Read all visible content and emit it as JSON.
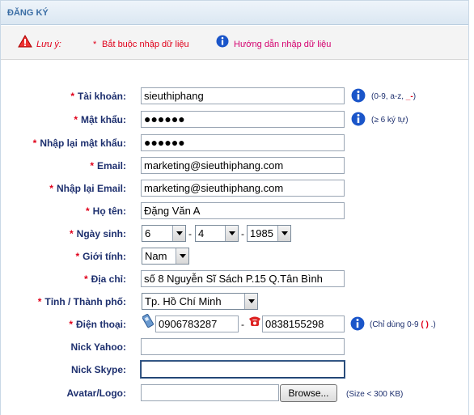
{
  "header": {
    "title": "ĐĂNG KÝ"
  },
  "notes": {
    "label": "Lưu ý:",
    "required_star": "*",
    "required_text": "Bắt buộc nhập dữ liệu",
    "help_text": "Hướng dẫn nhập dữ liệu"
  },
  "form": {
    "account": {
      "label": "Tài khoản:",
      "value": "sieuthiphang",
      "hint_prefix": "(0-9, a-z, ",
      "hint_symbols": "_-",
      "hint_suffix": ")"
    },
    "password": {
      "label": "Mật khẩu:",
      "value": "●●●●●●",
      "hint": "(≥ 6 ký tự)"
    },
    "password_confirm": {
      "label": "Nhập lại mật khẩu:",
      "value": "●●●●●●"
    },
    "email": {
      "label": "Email:",
      "value": "marketing@sieuthiphang.com"
    },
    "email_confirm": {
      "label": "Nhập lại Email:",
      "value": "marketing@sieuthiphang.com"
    },
    "fullname": {
      "label": "Họ tên:",
      "value": "Đặng Văn A"
    },
    "birthday": {
      "label": "Ngày sinh:",
      "day": "6",
      "month": "4",
      "year": "1985",
      "separator": "-"
    },
    "gender": {
      "label": "Giới tính:",
      "value": "Nam"
    },
    "address": {
      "label": "Địa chỉ:",
      "value": "số 8 Nguyễn Sĩ Sách P.15 Q.Tân Bình"
    },
    "city": {
      "label": "Tỉnh / Thành phố:",
      "value": "Tp. Hồ Chí Minh"
    },
    "phone": {
      "label": "Điện thoại:",
      "mobile": "0906783287",
      "landline": "0838155298",
      "separator": "-",
      "hint_prefix": "(Chỉ dùng 0-9 ",
      "hint_symbols": "( )",
      "hint_suffix": " .)"
    },
    "yahoo": {
      "label": "Nick Yahoo:",
      "value": ""
    },
    "skype": {
      "label": "Nick Skype:",
      "value": ""
    },
    "avatar": {
      "label": "Avatar/Logo:",
      "value": "",
      "button": "Browse...",
      "hint": "(Size < 300 KB)"
    },
    "required_star": "*"
  },
  "colors": {
    "label": "#1d2f6e",
    "required": "#e0001a",
    "title": "#3b6ea5",
    "help": "#d4006e"
  },
  "icons": [
    "warning-icon",
    "info-icon",
    "mobile-phone-icon",
    "telephone-icon"
  ]
}
